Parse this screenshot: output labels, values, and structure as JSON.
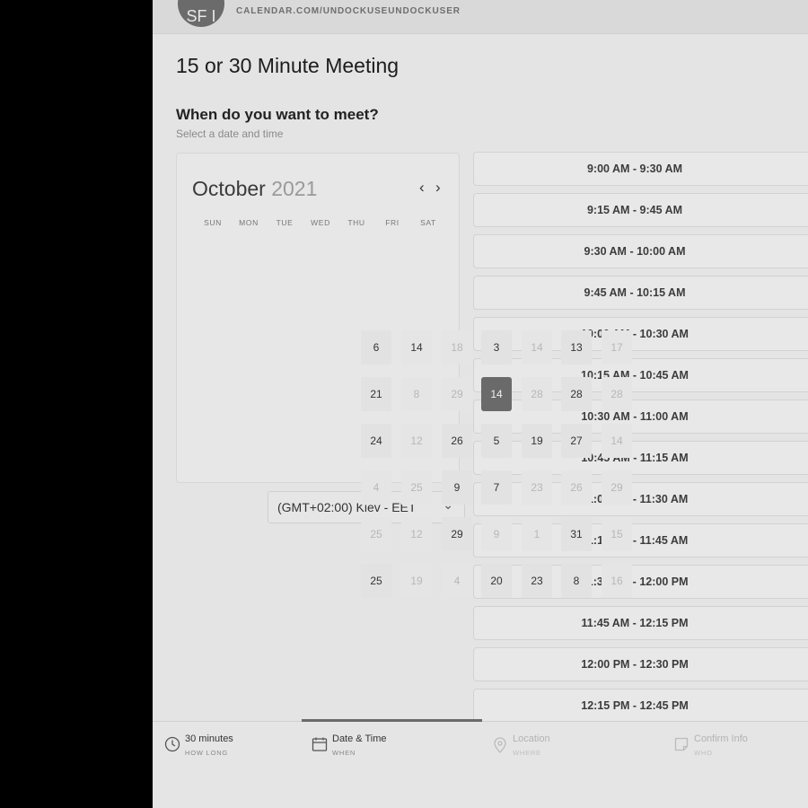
{
  "header": {
    "avatar_initials": "SF I",
    "url": "CALENDAR.COM/UNDOCKUSEUNDOCKUSER"
  },
  "meeting": {
    "title": "15 or 30 Minute Meeting"
  },
  "section": {
    "title": "When do you want to meet?",
    "subtitle": "Select a date and time"
  },
  "calendar": {
    "month": "October",
    "year": "2021",
    "prev_label": "‹",
    "next_label": "›",
    "weekdays": [
      "SUN",
      "MON",
      "TUE",
      "WED",
      "THU",
      "FRI",
      "SAT"
    ],
    "selected_day": "14",
    "day_cells": [
      [
        "6",
        "14",
        "18",
        "3",
        "14",
        "13",
        "17"
      ],
      [
        "21",
        "8",
        "29",
        "14",
        "28",
        "28",
        "28"
      ],
      [
        "24",
        "12",
        "26",
        "5",
        "19",
        "27",
        "14"
      ],
      [
        "4",
        "25",
        "9",
        "7",
        "23",
        "26",
        "29"
      ],
      [
        "25",
        "12",
        "29",
        "9",
        "1",
        "31",
        "15"
      ],
      [
        "25",
        "19",
        "4",
        "20",
        "23",
        "8",
        "16"
      ]
    ]
  },
  "timezone": {
    "value": "(GMT+02:00) Kiev - EET",
    "caret": "⌄"
  },
  "time_slots": [
    "9:00 AM - 9:30 AM",
    "9:15 AM - 9:45 AM",
    "9:30 AM - 10:00 AM",
    "9:45 AM - 10:15 AM",
    "10:00 AM - 10:30 AM",
    "10:15 AM - 10:45 AM",
    "10:30 AM - 11:00 AM",
    "10:45 AM - 11:15 AM",
    "11:00 AM - 11:30 AM",
    "11:15 AM - 11:45 AM",
    "11:30 AM - 12:00 PM",
    "11:45 AM - 12:15 PM",
    "12:00 PM - 12:30 PM",
    "12:15 PM - 12:45 PM"
  ],
  "steps": [
    {
      "title": "30 minutes",
      "sub": "HOW LONG",
      "icon": "clock-icon"
    },
    {
      "title": "Date & Time",
      "sub": "WHEN",
      "icon": "calendar-icon"
    },
    {
      "title": "Location",
      "sub": "WHERE",
      "icon": "location-pin-icon"
    },
    {
      "title": "Confirm Info",
      "sub": "WHO",
      "icon": "document-icon"
    }
  ],
  "colors": {
    "background": "#e4e4e4",
    "selected_day": "#6a6a6a",
    "side_panel": "#000000"
  }
}
